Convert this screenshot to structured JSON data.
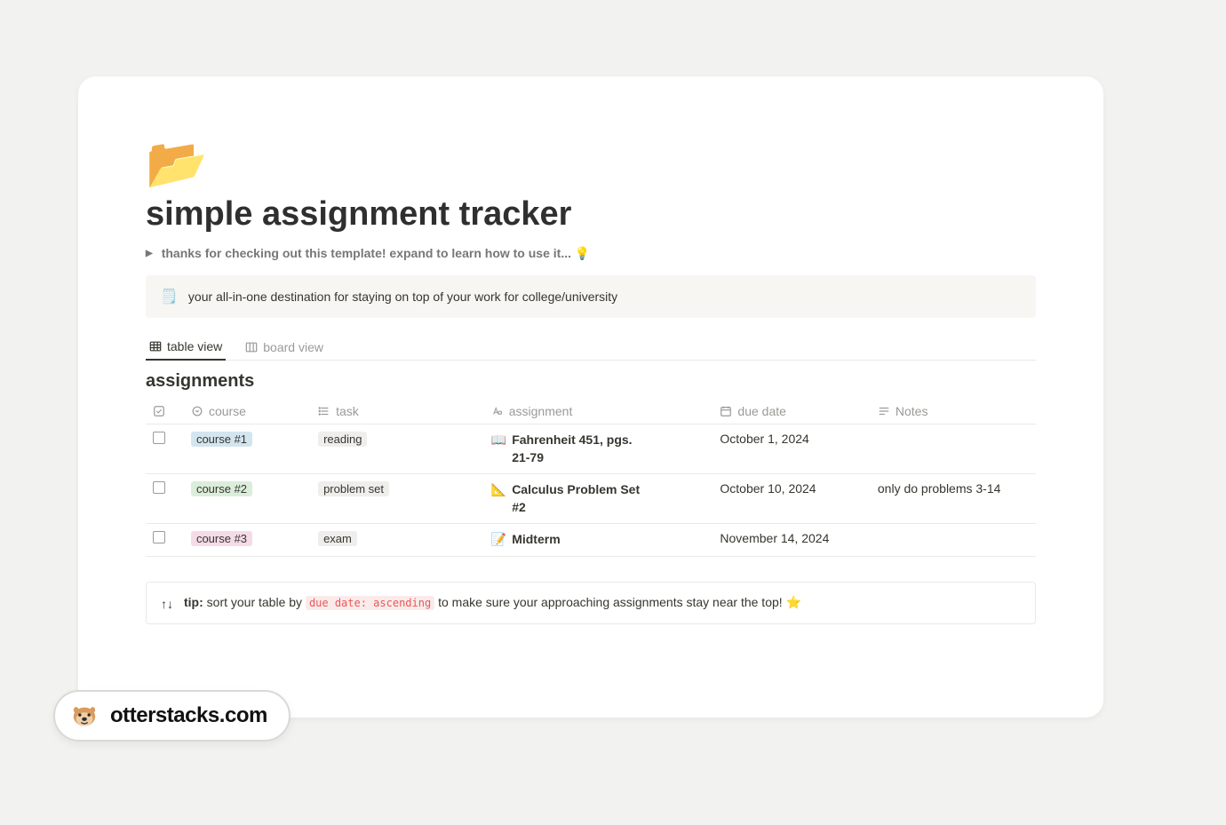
{
  "page": {
    "icon": "📂",
    "title": "simple assignment tracker"
  },
  "toggle": {
    "text": "thanks for checking out this template! expand to learn how to use it... 💡"
  },
  "info_callout": {
    "icon": "🗒️",
    "text": "your all-in-one destination for staying on top of your work for college/university"
  },
  "views": {
    "table": "table view",
    "board": "board view"
  },
  "database": {
    "title": "assignments",
    "columns": {
      "course": "course",
      "task": "task",
      "assignment": "assignment",
      "due_date": "due date",
      "notes": "Notes"
    },
    "rows": [
      {
        "course": "course #1",
        "course_color": "blue",
        "task": "reading",
        "assign_icon": "📖",
        "assign_text": "Fahrenheit 451, pgs. 21-79",
        "due": "October 1, 2024",
        "notes": ""
      },
      {
        "course": "course #2",
        "course_color": "green",
        "task": "problem set",
        "assign_icon": "📐",
        "assign_text": "Calculus Problem Set #2",
        "due": "October 10, 2024",
        "notes": "only do problems 3-14"
      },
      {
        "course": "course #3",
        "course_color": "pink",
        "task": "exam",
        "assign_icon": "📝",
        "assign_text": "Midterm",
        "due": "November 14, 2024",
        "notes": ""
      }
    ]
  },
  "tip": {
    "icon": "↑↓",
    "bold": "tip:",
    "before": " sort your table by ",
    "code": "due date: ascending",
    "after": " to make sure your approaching assignments stay near the top! ⭐"
  },
  "brand": {
    "text": "otterstacks.com"
  }
}
